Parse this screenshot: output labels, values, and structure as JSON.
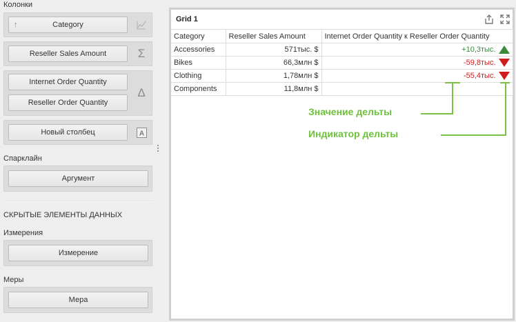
{
  "sidebar": {
    "columns_label": "Колонки",
    "columns": [
      {
        "label": "Category",
        "icon": "sort-ascending-icon",
        "option_icon": "chart-icon"
      },
      {
        "label": "Reseller Sales Amount",
        "option_icon": "sigma-icon"
      },
      {
        "delta_actual": "Internet Order Quantity",
        "delta_target": "Reseller Order Quantity",
        "option_icon": "delta-icon"
      },
      {
        "label": "Новый столбец",
        "option_icon": "text-column-icon"
      }
    ],
    "sparkline_label": "Спарклайн",
    "sparkline_button": "Аргумент",
    "hidden_header": "СКРЫТЫЕ ЭЛЕМЕНТЫ ДАННЫХ",
    "dimensions_label": "Измерения",
    "dimensions_button": "Измерение",
    "measures_label": "Меры",
    "measures_button": "Мера"
  },
  "grid": {
    "title": "Grid 1",
    "columns": [
      "Category",
      "Reseller Sales Amount",
      "Internet Order Quantity к Reseller Order Quantity"
    ],
    "rows": [
      {
        "category": "Accessories",
        "sales": "571тыс. $",
        "delta": "+10,3тыс.",
        "direction": "up"
      },
      {
        "category": "Bikes",
        "sales": "66,3млн $",
        "delta": "-59,8тыс.",
        "direction": "down"
      },
      {
        "category": "Clothing",
        "sales": "1,78млн $",
        "delta": "-55,4тыс.",
        "direction": "down"
      },
      {
        "category": "Components",
        "sales": "11,8млн $",
        "delta": "",
        "direction": ""
      }
    ],
    "colors": {
      "positive": "#3a8a3a",
      "negative": "#d01c1c",
      "annotation": "#6dc23a"
    }
  },
  "annotations": {
    "delta_value": "Значение дельты",
    "delta_indicator": "Индикатор дельты"
  }
}
